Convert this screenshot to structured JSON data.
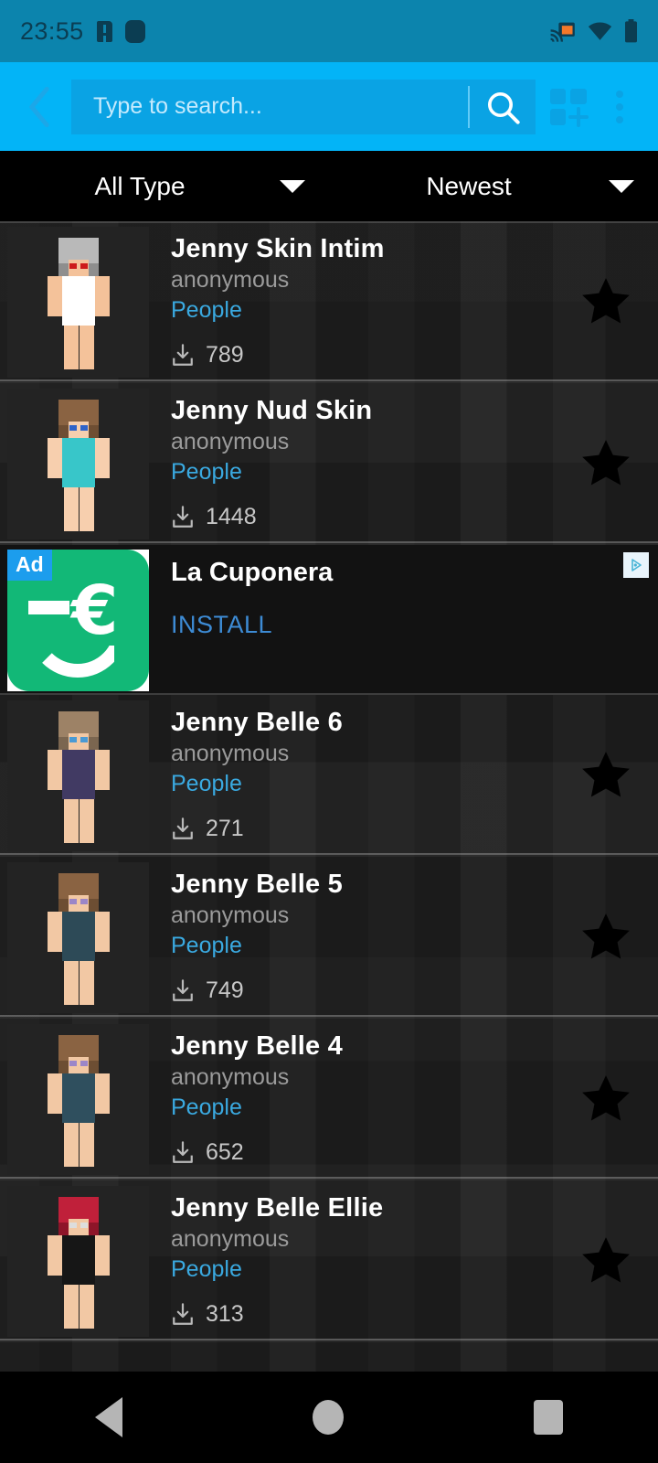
{
  "status_bar": {
    "time": "23:55",
    "icons": [
      "sim-alert-icon",
      "blob-icon",
      "cast-icon",
      "wifi-icon",
      "battery-icon"
    ],
    "background_color": "#0c84ad",
    "text_color": "#0b3d52"
  },
  "toolbar": {
    "back_label": "‹",
    "background_color": "#03b4f7",
    "search": {
      "value": "",
      "placeholder": "Type to search..."
    },
    "grid_add_label": "",
    "overflow_label": ""
  },
  "filters": [
    {
      "label": "All Type",
      "name": "type-filter"
    },
    {
      "label": "Newest",
      "name": "sort-filter"
    }
  ],
  "list": [
    {
      "title": "Jenny Skin Intim",
      "author": "anonymous",
      "category": "People",
      "downloads": "789",
      "favorited": false,
      "skin": {
        "hair": "#b9b9b9",
        "hair_dark": "#8e8e8e",
        "skin": "#f4c29a",
        "eye": "#cc1b1b",
        "cloth": "#ffffff"
      }
    },
    {
      "title": "Jenny Nud Skin",
      "author": "anonymous",
      "category": "People",
      "downloads": "1448",
      "favorited": false,
      "skin": {
        "hair": "#8a6342",
        "hair_dark": "#6e4e33",
        "skin": "#f7cfae",
        "eye": "#2f63c9",
        "cloth": "#38c6c9"
      }
    },
    {
      "title": "Jenny Belle 6",
      "author": "anonymous",
      "category": "People",
      "downloads": "271",
      "favorited": false,
      "skin": {
        "hair": "#9d8266",
        "hair_dark": "#7b6650",
        "skin": "#f2c8a4",
        "eye": "#4a9ad4",
        "cloth": "#413a63"
      }
    },
    {
      "title": "Jenny Belle 5",
      "author": "anonymous",
      "category": "People",
      "downloads": "749",
      "favorited": false,
      "skin": {
        "hair": "#8a6342",
        "hair_dark": "#6d4e33",
        "skin": "#f2c8a4",
        "eye": "#9b86c8",
        "cloth": "#2d4a57"
      }
    },
    {
      "title": "Jenny Belle 4",
      "author": "anonymous",
      "category": "People",
      "downloads": "652",
      "favorited": false,
      "skin": {
        "hair": "#8a6342",
        "hair_dark": "#6d4e33",
        "skin": "#f2c8a4",
        "eye": "#9b86c8",
        "cloth": "#2f4f5e"
      }
    },
    {
      "title": "Jenny Belle Ellie",
      "author": "anonymous",
      "category": "People",
      "downloads": "313",
      "favorited": false,
      "skin": {
        "hair": "#c0203a",
        "hair_dark": "#8e1529",
        "skin": "#f2c8a4",
        "eye": "#dddddd",
        "cloth": "#161616"
      }
    }
  ],
  "ad": {
    "badge": "Ad",
    "title": "La Cuponera",
    "cta": "INSTALL",
    "euro_glyph": "€",
    "adchoices_glyph": "▷",
    "icon_color": "#12b877",
    "badge_color": "#1c9ded"
  },
  "nav_bar": {
    "back": "back-triangle-icon",
    "home": "home-circle-icon",
    "recents": "recents-square-icon"
  },
  "colors": {
    "accent": "#03b4f7",
    "category_link": "#3aa9e0",
    "list_bg": "#1b1b1b"
  }
}
